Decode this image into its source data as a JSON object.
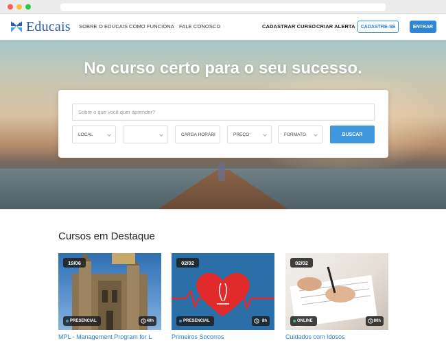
{
  "nav": {
    "brand": "Educais",
    "links": [
      "SOBRE O EDUCAIS",
      "COMO FUNCIONA",
      "FALE CONOSCO"
    ],
    "right_links": [
      "CADASTRAR CURSO",
      "CRIAR ALERTA"
    ],
    "signup": "CADASTRE-SE",
    "login": "ENTRAR"
  },
  "hero": {
    "title": "No curso certo para o seu sucesso.",
    "search_placeholder": "Sobre o que você quer aprender?",
    "filters": [
      "LOCAL",
      "",
      "CARGA HORÁRI",
      "PREÇO",
      "FORMATO"
    ],
    "search_button": "BUSCAR"
  },
  "featured": {
    "title": "Cursos em Destaque",
    "courses": [
      {
        "date": "19/06",
        "mode": "PRESENCIAL",
        "mode_color": "#3f98de",
        "hours": "40h",
        "title": "MPL - Management Program for L"
      },
      {
        "date": "02/02",
        "mode": "PRESENCIAL",
        "mode_color": "#3f98de",
        "hours": "8h",
        "title": "Primeiros Socorros"
      },
      {
        "date": "02/02",
        "mode": "ONLINE",
        "mode_color": "#3cc36a",
        "hours": "80h",
        "title": "Cuidados com Idosos"
      }
    ]
  },
  "colors": {
    "brand": "#2a5ba8",
    "accent": "#2f86d6"
  }
}
